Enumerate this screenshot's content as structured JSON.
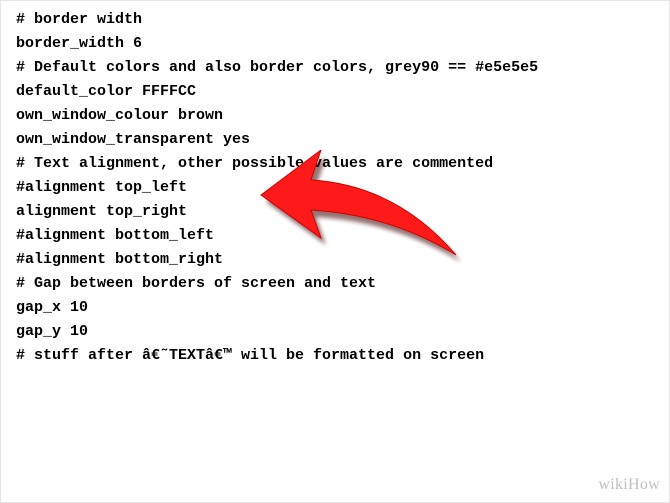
{
  "lines": {
    "l0": "# border width",
    "l1": "border_width 6",
    "l2": "",
    "l3": "# Default colors and also border colors, grey90 == #e5e5e5",
    "l4": "default_color FFFFCC",
    "l5": "",
    "l6": "own_window_colour brown",
    "l7": "own_window_transparent yes",
    "l8": "",
    "l9": "# Text alignment, other possible values are commented",
    "l10": "#alignment top_left",
    "l11": "alignment top_right",
    "l12": "#alignment bottom_left",
    "l13": "#alignment bottom_right",
    "l14": "",
    "l15": "# Gap between borders of screen and text",
    "l16": "gap_x 10",
    "l17": "gap_y 10",
    "l18": "",
    "l19": "# stuff after â€˜TEXTâ€™ will be formatted on screen"
  },
  "arrow": {
    "color": "#ff1a1a",
    "shadow": "#4d0000"
  },
  "watermark": {
    "text": "wikiHow"
  }
}
